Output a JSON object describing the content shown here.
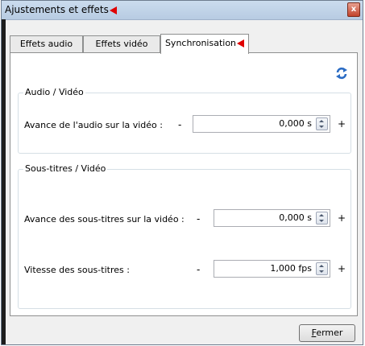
{
  "window": {
    "title": "Ajustements et effets",
    "close_glyph": "x"
  },
  "tabs": [
    {
      "label": "Effets audio"
    },
    {
      "label": "Effets vidéo"
    },
    {
      "label": "Synchronisation",
      "active": true
    }
  ],
  "groups": {
    "audio_video": {
      "title": "Audio / Vidéo",
      "rows": [
        {
          "label": "Avance de l'audio sur la vidéo :",
          "minus": "-",
          "value": "0,000 s",
          "plus": "+"
        }
      ]
    },
    "subtitles_video": {
      "title": "Sous-titres / Vidéo",
      "rows": [
        {
          "label": "Avance des sous-titres sur la vidéo :",
          "minus": "-",
          "value": "0,000 s",
          "plus": "+"
        },
        {
          "label": "Vitesse des sous-titres :",
          "minus": "-",
          "value": "1,000 fps",
          "plus": "+"
        }
      ]
    }
  },
  "footer": {
    "close_first_letter": "F",
    "close_rest": "ermer"
  },
  "icons": {
    "refresh": "refresh-icon",
    "marker": "red-arrow-marker"
  },
  "colors": {
    "marker": "#e00000",
    "refresh_blue": "#2b6cc4"
  }
}
